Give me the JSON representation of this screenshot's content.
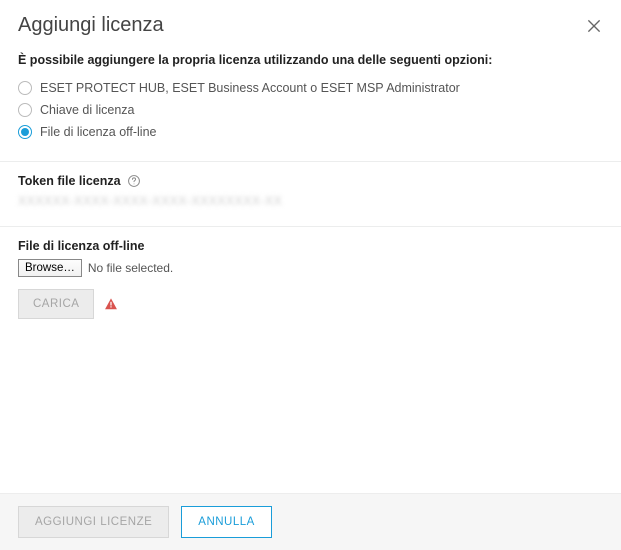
{
  "dialog": {
    "title": "Aggiungi licenza",
    "prompt": "È possibile aggiungere la propria licenza utilizzando una delle seguenti opzioni:",
    "options": [
      {
        "label": "ESET PROTECT HUB, ESET Business Account o ESET MSP Administrator",
        "selected": false
      },
      {
        "label": "Chiave di licenza",
        "selected": false
      },
      {
        "label": "File di licenza off-line",
        "selected": true
      }
    ]
  },
  "token": {
    "label": "Token file licenza",
    "value": "XXXXXX-XXXX-XXXX-XXXX-XXXXXXXX-XX"
  },
  "file": {
    "label": "File di licenza off-line",
    "browse": "Browse…",
    "status": "No file selected.",
    "upload": "CARICA"
  },
  "footer": {
    "confirm": "AGGIUNGI LICENZE",
    "cancel": "ANNULLA"
  }
}
